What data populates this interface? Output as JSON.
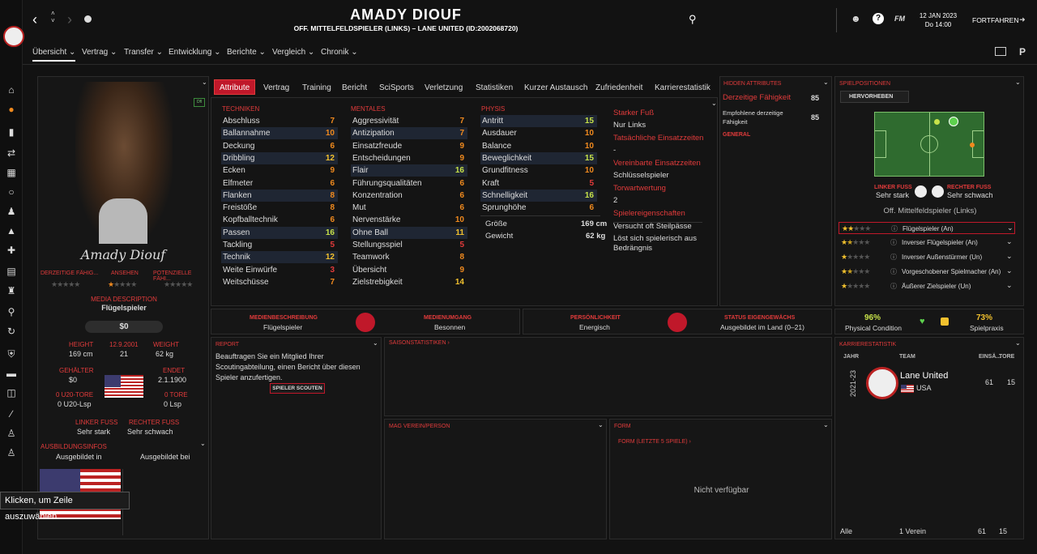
{
  "header": {
    "player_name": "AMADY DIOUF",
    "subtitle": "OFF. MITTELFELDSPIELER (LINKS) – LANE UNITED (ID:2002068720)",
    "date": "12 JAN 2023",
    "time": "Do 14:00",
    "continue": "FORTFAHREN",
    "fm": "FM"
  },
  "subnav": [
    "Übersicht",
    "Vertrag",
    "Transfer",
    "Entwicklung",
    "Berichte",
    "Vergleich",
    "Chronik"
  ],
  "tabs": [
    "Attribute",
    "Vertrag",
    "Training",
    "Bericht",
    "SciSports",
    "Verletzung",
    "Statistiken",
    "Kurzer Austausch",
    "Zufriedenheit",
    "Karrierestatistik"
  ],
  "profile": {
    "signature": "Amady Diouf",
    "dfl_badge": "Dfl",
    "labels": [
      "DERZEITIGE FÄHIG...",
      "ANSEHEN",
      "POTENZIELLE FÄHI..."
    ],
    "media_desc_label": "MEDIA DESCRIPTION",
    "media_desc": "Flügelspieler",
    "value": "$0",
    "height_label": "HEIGHT",
    "height": "169 cm",
    "dob": "12.9.2001",
    "age": "21",
    "weight_label": "WEIGHT",
    "weight": "62 kg",
    "wage_label": "GEHÄLTER",
    "wage": "$0",
    "ends_label": "ENDET",
    "ends": "2.1.1900",
    "u20_goals_label": "0 U20-TORE",
    "u20_lsp": "0 U20-Lsp",
    "goals_label": "0 TORE",
    "lsp": "0 Lsp",
    "left_foot_label": "LINKER FUSS",
    "left_foot": "Sehr stark",
    "right_foot_label": "RECHTER FUSS",
    "right_foot": "Sehr schwach",
    "training_label": "AUSBILDUNGSINFOS",
    "trained_in": "Ausgebildet in",
    "trained_at": "Ausgebildet bei",
    "tooltip": "Klicken, um Zeile auszuwählen."
  },
  "attributes": {
    "tech_label": "TECHNIKEN",
    "mental_label": "MENTALES",
    "phys_label": "PHYSIS",
    "technical": [
      {
        "n": "Abschluss",
        "v": "7"
      },
      {
        "n": "Ballannahme",
        "v": "10"
      },
      {
        "n": "Deckung",
        "v": "6"
      },
      {
        "n": "Dribbling",
        "v": "12"
      },
      {
        "n": "Ecken",
        "v": "9"
      },
      {
        "n": "Elfmeter",
        "v": "6"
      },
      {
        "n": "Flanken",
        "v": "8"
      },
      {
        "n": "Freistöße",
        "v": "8"
      },
      {
        "n": "Kopfballtechnik",
        "v": "6"
      },
      {
        "n": "Passen",
        "v": "16"
      },
      {
        "n": "Tackling",
        "v": "5"
      },
      {
        "n": "Technik",
        "v": "12"
      },
      {
        "n": "Weite Einwürfe",
        "v": "3"
      },
      {
        "n": "Weitschüsse",
        "v": "7"
      }
    ],
    "mental": [
      {
        "n": "Aggressivität",
        "v": "7"
      },
      {
        "n": "Antizipation",
        "v": "7"
      },
      {
        "n": "Einsatzfreude",
        "v": "9"
      },
      {
        "n": "Entscheidungen",
        "v": "9"
      },
      {
        "n": "Flair",
        "v": "16"
      },
      {
        "n": "Führungsqualitäten",
        "v": "6"
      },
      {
        "n": "Konzentration",
        "v": "6"
      },
      {
        "n": "Mut",
        "v": "6"
      },
      {
        "n": "Nervenstärke",
        "v": "10"
      },
      {
        "n": "Ohne Ball",
        "v": "11"
      },
      {
        "n": "Stellungsspiel",
        "v": "5"
      },
      {
        "n": "Teamwork",
        "v": "8"
      },
      {
        "n": "Übersicht",
        "v": "9"
      },
      {
        "n": "Zielstrebigkeit",
        "v": "14"
      }
    ],
    "physical": [
      {
        "n": "Antritt",
        "v": "15"
      },
      {
        "n": "Ausdauer",
        "v": "10"
      },
      {
        "n": "Balance",
        "v": "10"
      },
      {
        "n": "Beweglichkeit",
        "v": "15"
      },
      {
        "n": "Grundfitness",
        "v": "10"
      },
      {
        "n": "Kraft",
        "v": "5"
      },
      {
        "n": "Schnelligkeit",
        "v": "16"
      },
      {
        "n": "Sprunghöhe",
        "v": "6"
      }
    ],
    "size_label": "Größe",
    "size": "169 cm",
    "weight_label": "Gewicht",
    "weight": "62 kg"
  },
  "info": {
    "foot_label": "Starker Fuß",
    "foot": "Nur Links",
    "positions_label": "Tatsächliche Einsatzzeiten",
    "positions": "-",
    "agreed_label": "Vereinbarte Einsatzzeiten",
    "agreed": "Schlüsselspieler",
    "goals_label": "Torwartwertung",
    "goals": "2",
    "traits_label": "Spielereigenschaften",
    "traits": [
      "Versucht oft Steilpässe",
      "Löst sich spielerisch aus Bedrängnis"
    ]
  },
  "hidden": {
    "title": "HIDDEN ATTRIBUTES",
    "current_label": "Derzeitige Fähigkeit",
    "current": "85",
    "recommended_label": "Empfohlene derzeitige Fähigkeit",
    "recommended": "85",
    "general": "GENERAL"
  },
  "positions": {
    "title": "SPIELPOSITIONEN",
    "highlight": "HERVORHEBEN",
    "left_foot_label": "LINKER FUSS",
    "left_foot": "Sehr stark",
    "right_foot_label": "RECHTER FUSS",
    "right_foot": "Sehr schwach",
    "position": "Off. Mittelfeldspieler (Links)",
    "roles": [
      "Flügelspieler (An)",
      "Inverser Flügelspieler (An)",
      "Inverser Außenstürmer (Un)",
      "Vorgeschobener Spielmacher (An)",
      "Äußerer Zielspieler (Un)"
    ]
  },
  "media": {
    "desc_label": "MEDIENBESCHREIBUNG",
    "desc": "Flügelspieler",
    "handling_label": "MEDIENUMGANG",
    "handling": "Besonnen",
    "personality_label": "PERSÖNLICHKEIT",
    "personality": "Energisch",
    "homegrown_label": "STATUS EIGENGEWÄCHS",
    "homegrown": "Ausgebildet im Land (0–21)"
  },
  "condition": {
    "physical": "96%",
    "physical_label": "Physical Condition",
    "practice": "73%",
    "practice_label": "Spielpraxis"
  },
  "report": {
    "title": "REPORT",
    "text": "Beauftragen Sie ein Mitglied Ihrer Scoutingabteilung, einen Bericht über diesen Spieler anzufertigen.",
    "button": "SPIELER SCOUTEN"
  },
  "season_stats": "SAISONSTATISTIKEN",
  "likes": "MAG VEREIN/PERSON",
  "form": {
    "title": "FORM",
    "sub": "FORM (LETZTE 5 SPIELE)",
    "empty": "Nicht verfügbar"
  },
  "career": {
    "title": "KARRIERESTATISTIK",
    "col_year": "JAHR",
    "col_team": "TEAM",
    "col_apps": "EINSÄ...",
    "col_goals": "TORE",
    "season": "2021-23",
    "team": "Lane United",
    "country": "USA",
    "apps": "61",
    "goals_v": "15",
    "all": "Alle",
    "club_count": "1 Verein",
    "total_apps": "61",
    "total_goals": "15"
  }
}
